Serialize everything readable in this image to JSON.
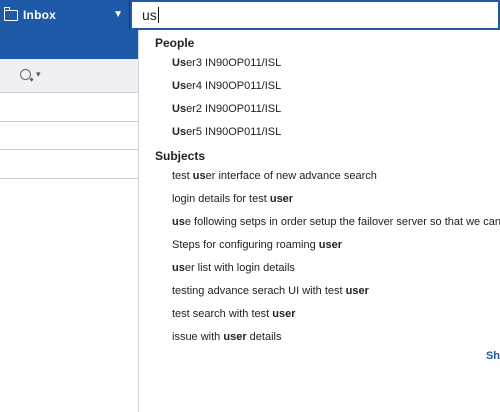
{
  "left_pane": {
    "folder_label": "Inbox",
    "folder_icon": "folder-icon",
    "search_icon": "search-icon"
  },
  "search": {
    "query": "us"
  },
  "suggestions": {
    "people_header": "People",
    "people": [
      {
        "match": "Us",
        "rest": "er3 IN90OP011/ISL"
      },
      {
        "match": "Us",
        "rest": "er4 IN90OP011/ISL"
      },
      {
        "match": "Us",
        "rest": "er2 IN90OP011/ISL"
      },
      {
        "match": "Us",
        "rest": "er5 IN90OP011/ISL"
      }
    ],
    "subjects_header": "Subjects",
    "subjects": [
      {
        "pre": "test ",
        "match": "us",
        "post": "er interface of new advance search"
      },
      {
        "pre": "login details for test ",
        "match": "user",
        "post": ""
      },
      {
        "pre": "",
        "match": "us",
        "post": "e following setps in order setup the failover server so that we can re"
      },
      {
        "pre": "Steps for configuring roaming ",
        "match": "user",
        "post": ""
      },
      {
        "pre": "",
        "match": "us",
        "post": "er list with login details"
      },
      {
        "pre": "testing advance serach UI with test ",
        "match": "user",
        "post": ""
      },
      {
        "pre": "test search with test ",
        "match": "user",
        "post": ""
      },
      {
        "pre": "issue with ",
        "match": "user",
        "post": " details"
      }
    ],
    "show_more": "Sh"
  },
  "colors": {
    "accent": "#1e5aa8"
  }
}
